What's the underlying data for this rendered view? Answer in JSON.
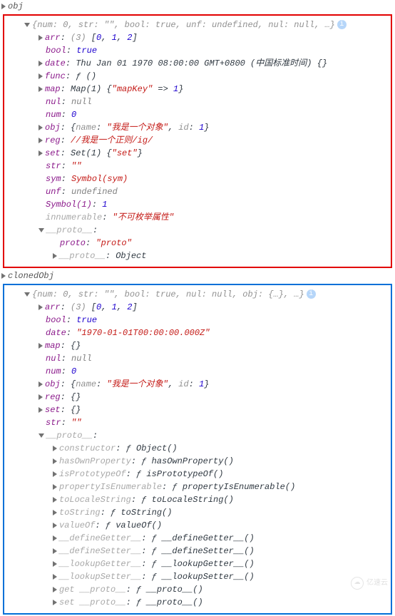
{
  "obj": {
    "header": "obj",
    "summary": "{num: 0, str: \"\", bool: true, unf: undefined, nul: null, …}",
    "props": {
      "arr": {
        "key": "arr",
        "len": "(3)",
        "preview": "[0, 1, 2]"
      },
      "bool": {
        "key": "bool",
        "value": "true"
      },
      "date": {
        "key": "date",
        "value": "Thu Jan 01 1970 08:00:00 GMT+0800 (中国标准时间) {}"
      },
      "func": {
        "key": "func",
        "value": "ƒ ()"
      },
      "map": {
        "key": "map",
        "value": "Map(1) {\"mapKey\" => 1}"
      },
      "nul": {
        "key": "nul",
        "value": "null"
      },
      "num": {
        "key": "num",
        "value": "0"
      },
      "objName": {
        "key": "obj",
        "name": "\"我是一个对象\"",
        "id": "1"
      },
      "reg": {
        "key": "reg",
        "value": "//我是一个正则/ig/"
      },
      "set": {
        "key": "set",
        "value": "Set(1) {\"set\"}"
      },
      "str": {
        "key": "str",
        "value": "\"\""
      },
      "sym": {
        "key": "sym",
        "value": "Symbol(sym)"
      },
      "unf": {
        "key": "unf",
        "value": "undefined"
      },
      "symbol1": {
        "key": "Symbol(1)",
        "value": "1"
      },
      "innumerable": {
        "key": "innumerable",
        "value": "\"不可枚举属性\""
      },
      "proto": {
        "key": "__proto__",
        "proto": {
          "key": "proto",
          "value": "\"proto\""
        },
        "protoProto": {
          "key": "__proto__",
          "value": "Object"
        }
      }
    }
  },
  "clonedObj": {
    "header": "clonedObj",
    "summary": "{num: 0, str: \"\", bool: true, nul: null, obj: {…}, …}",
    "props": {
      "arr": {
        "key": "arr",
        "len": "(3)",
        "preview": "[0, 1, 2]"
      },
      "bool": {
        "key": "bool",
        "value": "true"
      },
      "date": {
        "key": "date",
        "value": "\"1970-01-01T00:00:00.000Z\""
      },
      "map": {
        "key": "map",
        "value": "{}"
      },
      "nul": {
        "key": "nul",
        "value": "null"
      },
      "num": {
        "key": "num",
        "value": "0"
      },
      "objName": {
        "key": "obj",
        "name": "\"我是一个对象\"",
        "id": "1"
      },
      "reg": {
        "key": "reg",
        "value": "{}"
      },
      "set": {
        "key": "set",
        "value": "{}"
      },
      "str": {
        "key": "str",
        "value": "\"\""
      },
      "proto": {
        "key": "__proto__",
        "constructor": {
          "key": "constructor",
          "value": "ƒ Object()"
        },
        "hasOwnProperty": {
          "key": "hasOwnProperty",
          "value": "ƒ hasOwnProperty()"
        },
        "isPrototypeOf": {
          "key": "isPrototypeOf",
          "value": "ƒ isPrototypeOf()"
        },
        "propertyIsEnumerable": {
          "key": "propertyIsEnumerable",
          "value": "ƒ propertyIsEnumerable()"
        },
        "toLocaleString": {
          "key": "toLocaleString",
          "value": "ƒ toLocaleString()"
        },
        "toString": {
          "key": "toString",
          "value": "ƒ toString()"
        },
        "valueOf": {
          "key": "valueOf",
          "value": "ƒ valueOf()"
        },
        "defineGetter": {
          "key": "__defineGetter__",
          "value": "ƒ __defineGetter__()"
        },
        "defineSetter": {
          "key": "__defineSetter__",
          "value": "ƒ __defineSetter__()"
        },
        "lookupGetter": {
          "key": "__lookupGetter__",
          "value": "ƒ __lookupGetter__()"
        },
        "lookupSetter": {
          "key": "__lookupSetter__",
          "value": "ƒ __lookupSetter__()"
        },
        "getProto": {
          "key": "get __proto__",
          "value": "ƒ __proto__()"
        },
        "setProto": {
          "key": "set __proto__",
          "value": "ƒ __proto__()"
        }
      }
    }
  },
  "labels": {
    "name": "name",
    "id": "id"
  },
  "watermark": "亿速云"
}
